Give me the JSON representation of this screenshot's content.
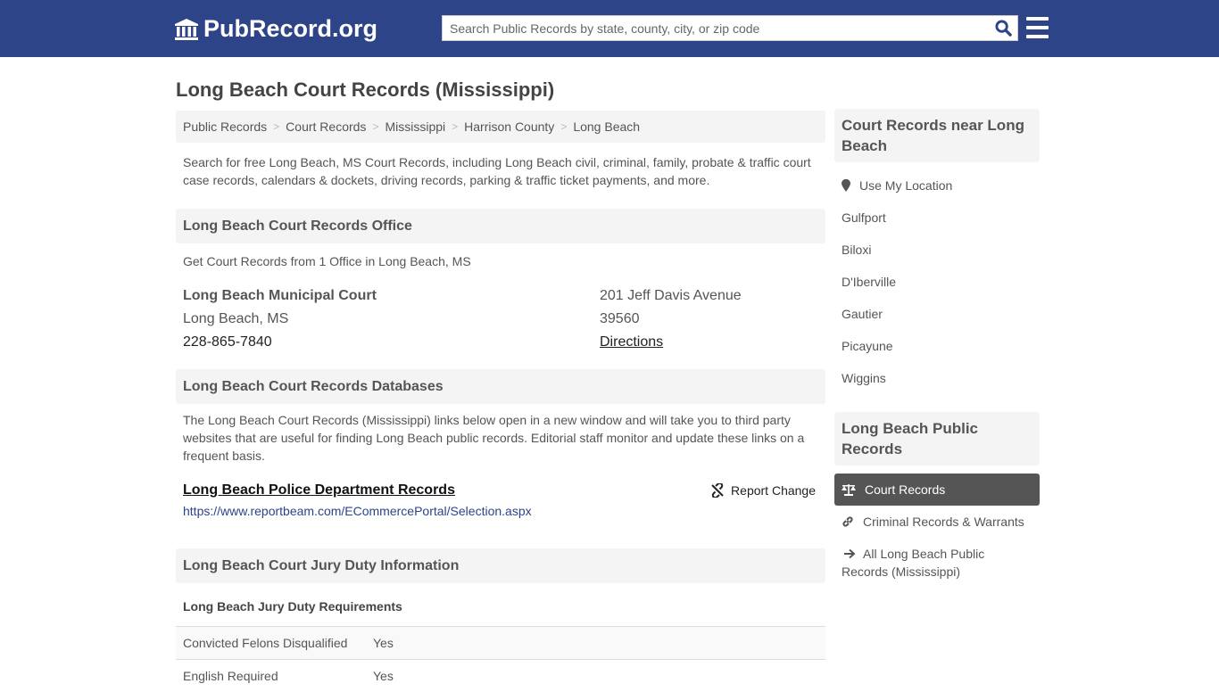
{
  "header": {
    "logo_text": "PubRecord.org",
    "search_placeholder": "Search Public Records by state, county, city, or zip code",
    "brand_color": "#2d4489"
  },
  "page": {
    "title": "Long Beach Court Records (Mississippi)"
  },
  "breadcrumb": [
    {
      "label": "Public Records"
    },
    {
      "label": "Court Records"
    },
    {
      "label": "Mississippi"
    },
    {
      "label": "Harrison County"
    },
    {
      "label": "Long Beach"
    }
  ],
  "intro": "Search for free Long Beach, MS Court Records, including Long Beach civil, criminal, family, probate & traffic court case records, calendars & dockets, driving records, parking & traffic ticket payments, and more.",
  "office_section": {
    "heading": "Long Beach Court Records Office",
    "subtitle": "Get Court Records from 1 Office in Long Beach, MS",
    "offices": [
      {
        "name": "Long Beach Municipal Court",
        "city_state": "Long Beach, MS",
        "phone": "228-865-7840",
        "address": "201 Jeff Davis Avenue",
        "zip": "39560",
        "directions_label": "Directions"
      }
    ]
  },
  "databases_section": {
    "heading": "Long Beach Court Records Databases",
    "description": "The Long Beach Court Records (Mississippi) links below open in a new window and will take you to third party websites that are useful for finding Long Beach public records. Editorial staff monitor and update these links on a frequent basis.",
    "links": [
      {
        "title": "Long Beach Police Department Records",
        "url": "https://www.reportbeam.com/ECommercePortal/Selection.aspx",
        "report_label": "Report Change"
      }
    ]
  },
  "jury_section": {
    "heading": "Long Beach Court Jury Duty Information",
    "subheading": "Long Beach Jury Duty Requirements",
    "rows": [
      {
        "key": "Convicted Felons Disqualified",
        "value": "Yes"
      },
      {
        "key": "English Required",
        "value": "Yes"
      }
    ]
  },
  "sidebar": {
    "nearby_heading": "Court Records near Long Beach",
    "use_location_label": "Use My Location",
    "nearby": [
      "Gulfport",
      "Biloxi",
      "D'Iberville",
      "Gautier",
      "Picayune",
      "Wiggins"
    ],
    "public_heading": "Long Beach Public Records",
    "public_items": [
      {
        "label": "Court Records",
        "icon": "scale-icon",
        "active": true
      },
      {
        "label": "Criminal Records & Warrants",
        "icon": "link-icon",
        "active": false
      },
      {
        "label": "All Long Beach Public Records (Mississippi)",
        "icon": "arrow-right-icon",
        "active": false
      }
    ]
  }
}
